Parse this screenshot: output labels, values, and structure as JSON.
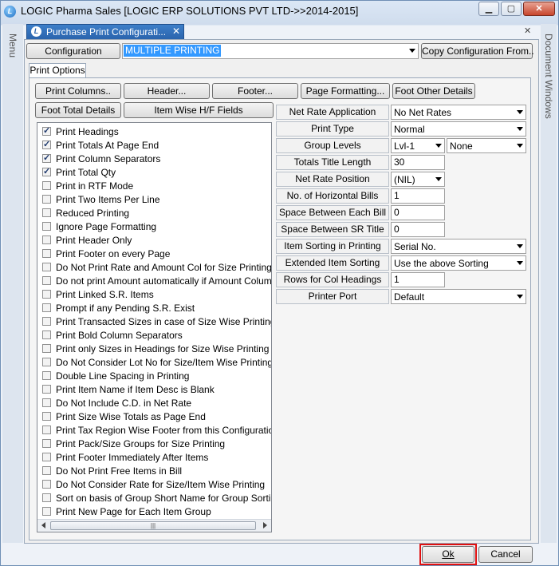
{
  "window": {
    "title": "LOGIC Pharma Sales  [LOGIC ERP SOLUTIONS PVT LTD->>2014-2015]",
    "app_icon": "L"
  },
  "sidebar": {
    "left_label": "Menu",
    "right_label": "Document Windows"
  },
  "tab": {
    "label": "Purchase Print Configurati...",
    "close": "✕"
  },
  "configuration": {
    "label": "Configuration",
    "value": "MULTIPLE PRINTING",
    "copy_button": "Copy Configuration From.."
  },
  "print_options_tab": "Print Options",
  "toolbar": {
    "print_columns": "Print Columns..",
    "header": "Header...",
    "footer": "Footer...",
    "page_formatting": "Page Formatting...",
    "foot_other_details": "Foot Other Details",
    "foot_total_details": "Foot Total Details",
    "item_wise_hf": "Item Wise H/F Fields"
  },
  "options": [
    {
      "label": "Print Headings",
      "checked": true
    },
    {
      "label": "Print Totals At Page End",
      "checked": true
    },
    {
      "label": "Print Column Separators",
      "checked": true
    },
    {
      "label": "Print Total Qty",
      "checked": true
    },
    {
      "label": "Print in RTF Mode",
      "checked": false
    },
    {
      "label": "Print Two Items Per Line",
      "checked": false
    },
    {
      "label": "Reduced Printing",
      "checked": false
    },
    {
      "label": "Ignore Page Formatting",
      "checked": false
    },
    {
      "label": "Print Header Only",
      "checked": false
    },
    {
      "label": "Print Footer on every Page",
      "checked": false
    },
    {
      "label": "Do Not Print Rate and Amount Col for Size Printing",
      "checked": false
    },
    {
      "label": "Do not print Amount automatically if Amount Column is not",
      "checked": false
    },
    {
      "label": "Print Linked S.R. Items",
      "checked": false
    },
    {
      "label": "Prompt if any Pending S.R. Exist",
      "checked": false
    },
    {
      "label": "Print Transacted Sizes in case of Size Wise Printing",
      "checked": false
    },
    {
      "label": "Print Bold Column Separators",
      "checked": false
    },
    {
      "label": "Print only Sizes in Headings for Size Wise Printing",
      "checked": false
    },
    {
      "label": "Do Not Consider Lot No for Size/Item Wise Printing",
      "checked": false
    },
    {
      "label": "Double Line Spacing in Printing",
      "checked": false
    },
    {
      "label": "Print Item Name if Item Desc is Blank",
      "checked": false
    },
    {
      "label": "Do Not Include C.D. in Net Rate",
      "checked": false
    },
    {
      "label": "Print Size Wise Totals as Page End",
      "checked": false
    },
    {
      "label": "Print Tax Region Wise Footer from this Configuration",
      "checked": false
    },
    {
      "label": "Print Pack/Size Groups for Size Printing",
      "checked": false
    },
    {
      "label": "Print Footer Immediately After Items",
      "checked": false
    },
    {
      "label": "Do Not Print Free Items in Bill",
      "checked": false
    },
    {
      "label": "Do Not Consider Rate for Size/Item Wise Printing",
      "checked": false
    },
    {
      "label": "Sort on basis of Group Short Name for Group Sorting",
      "checked": false
    },
    {
      "label": "Print New Page for Each Item Group",
      "checked": false
    }
  ],
  "properties": {
    "net_rate_application": {
      "label": "Net Rate Application",
      "value": "No Net Rates"
    },
    "print_type": {
      "label": "Print Type",
      "value": "Normal"
    },
    "group_levels": {
      "label": "Group Levels",
      "value": "Lvl-1",
      "value2": "None"
    },
    "totals_title_length": {
      "label": "Totals Title Length",
      "value": "30"
    },
    "net_rate_position": {
      "label": "Net Rate Position",
      "value": "(NIL)"
    },
    "horizontal_bills": {
      "label": "No. of Horizontal Bills",
      "value": "1"
    },
    "space_between_bill": {
      "label": "Space Between Each Bill",
      "value": "0"
    },
    "space_between_sr": {
      "label": "Space Between SR Title",
      "value": "0"
    },
    "item_sorting": {
      "label": "Item Sorting in Printing",
      "value": "Serial No."
    },
    "extended_item_sorting": {
      "label": "Extended Item Sorting",
      "value": "Use the above Sorting"
    },
    "rows_col_headings": {
      "label": "Rows for Col Headings",
      "value": "1"
    },
    "printer_port": {
      "label": "Printer Port",
      "value": "Default"
    }
  },
  "footer_buttons": {
    "ok": "Ok",
    "cancel": "Cancel"
  },
  "colors": {
    "highlight": "#e01010",
    "selection": "#3399ff",
    "tab": "#2a64ad"
  }
}
